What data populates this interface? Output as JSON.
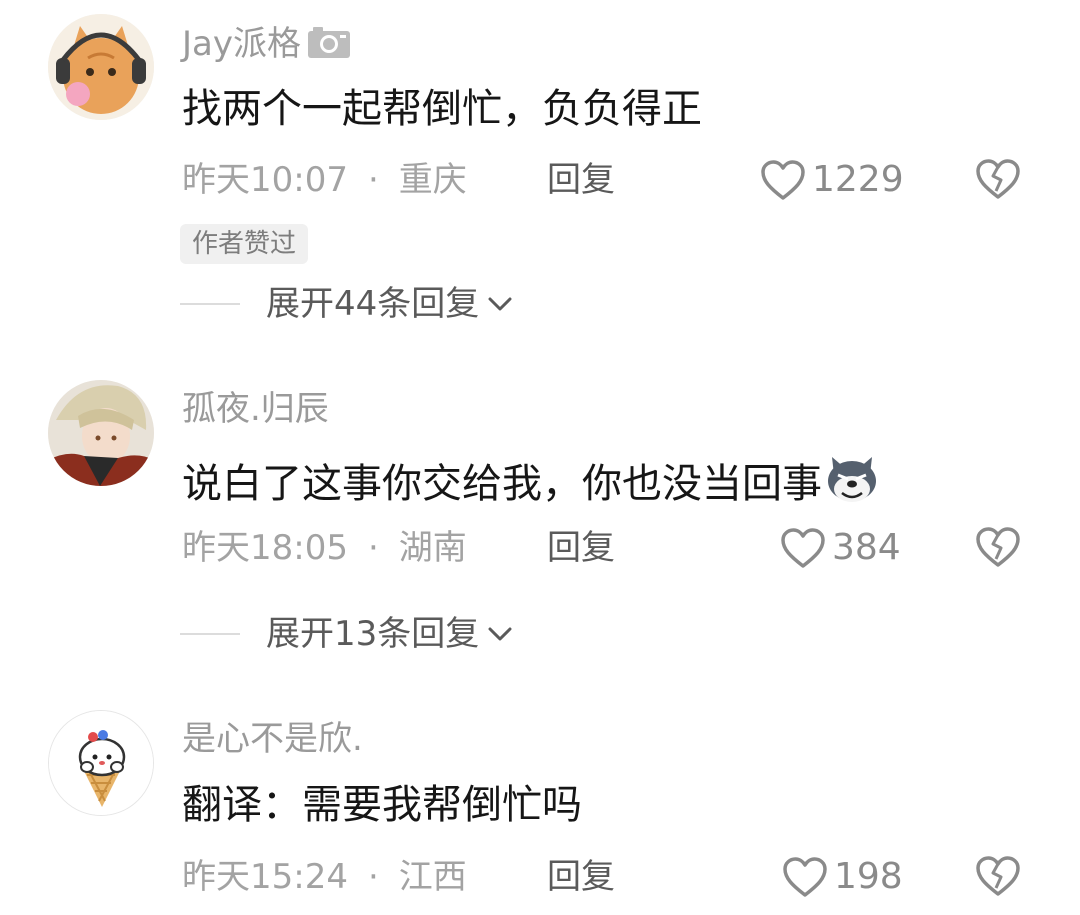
{
  "comments": [
    {
      "username": "Jay派格",
      "has_camera_badge": true,
      "text": "找两个一起帮倒忙，负负得正",
      "time": "昨天10:07",
      "location": "重庆",
      "reply_label": "回复",
      "likes": "1229",
      "author_liked_badge": "作者赞过",
      "expand_label": "展开44条回复"
    },
    {
      "username": "孤夜.归辰",
      "text": "说白了这事你交给我，你也没当回事",
      "emoji": "dog-emoji",
      "time": "昨天18:05",
      "location": "湖南",
      "reply_label": "回复",
      "likes": "384",
      "expand_label": "展开13条回复"
    },
    {
      "username": "是心不是欣.",
      "text": "翻译：需要我帮倒忙吗",
      "time": "昨天15:24",
      "location": "江西",
      "reply_label": "回复",
      "likes": "198"
    }
  ],
  "separator": "·",
  "icons": {
    "like": "heart-outline-icon",
    "dislike": "broken-heart-icon",
    "expand": "chevron-down-icon",
    "camera": "camera-icon"
  },
  "colors": {
    "username": "#9a9a9a",
    "text": "#161616",
    "meta": "#a3a3a3",
    "action": "#5a5a5a"
  }
}
